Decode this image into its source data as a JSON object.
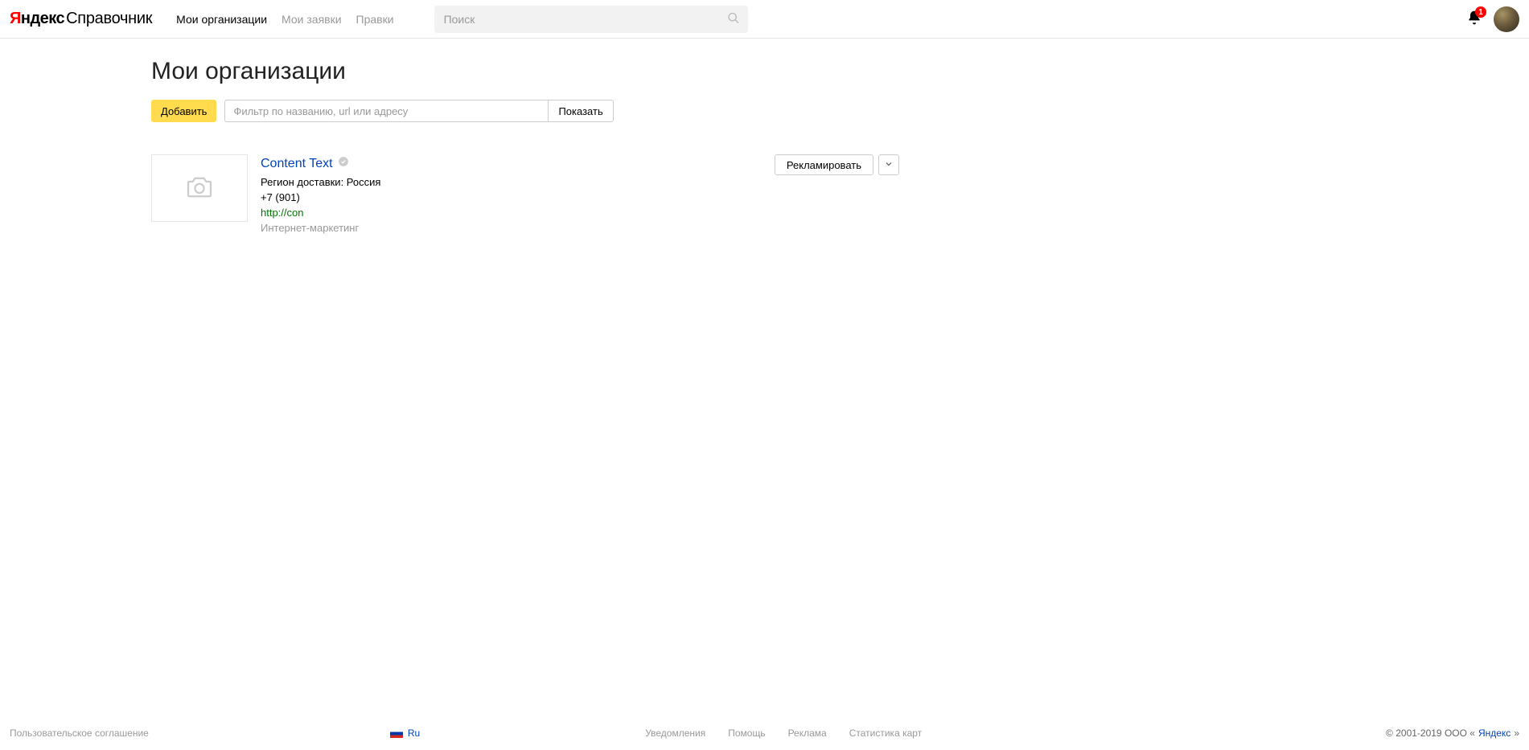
{
  "header": {
    "logo_red": "Я",
    "logo_black": "ндекс",
    "logo_service": "Справочник",
    "nav": [
      {
        "label": "Мои организации",
        "active": true
      },
      {
        "label": "Мои заявки",
        "active": false
      },
      {
        "label": "Правки",
        "active": false
      }
    ],
    "search_placeholder": "Поиск",
    "notifications_count": "1"
  },
  "page": {
    "title": "Мои организации",
    "add_button": "Добавить",
    "filter_placeholder": "Фильтр по названию, url или адресу",
    "show_button": "Показать"
  },
  "org": {
    "title": "Content Text",
    "region": "Регион доставки: Россия",
    "phone": "+7 (901)",
    "url": "http://con",
    "category": "Интернет-маркетинг",
    "advertise_label": "Рекламировать"
  },
  "footer": {
    "terms": "Пользовательское соглашение",
    "lang": "Ru",
    "links": [
      {
        "label": "Уведомления"
      },
      {
        "label": "Помощь"
      },
      {
        "label": "Реклама"
      },
      {
        "label": "Статистика карт"
      }
    ],
    "copyright_prefix": "© 2001-2019  ООО «",
    "copyright_link": "Яндекс",
    "copyright_suffix": "»"
  }
}
